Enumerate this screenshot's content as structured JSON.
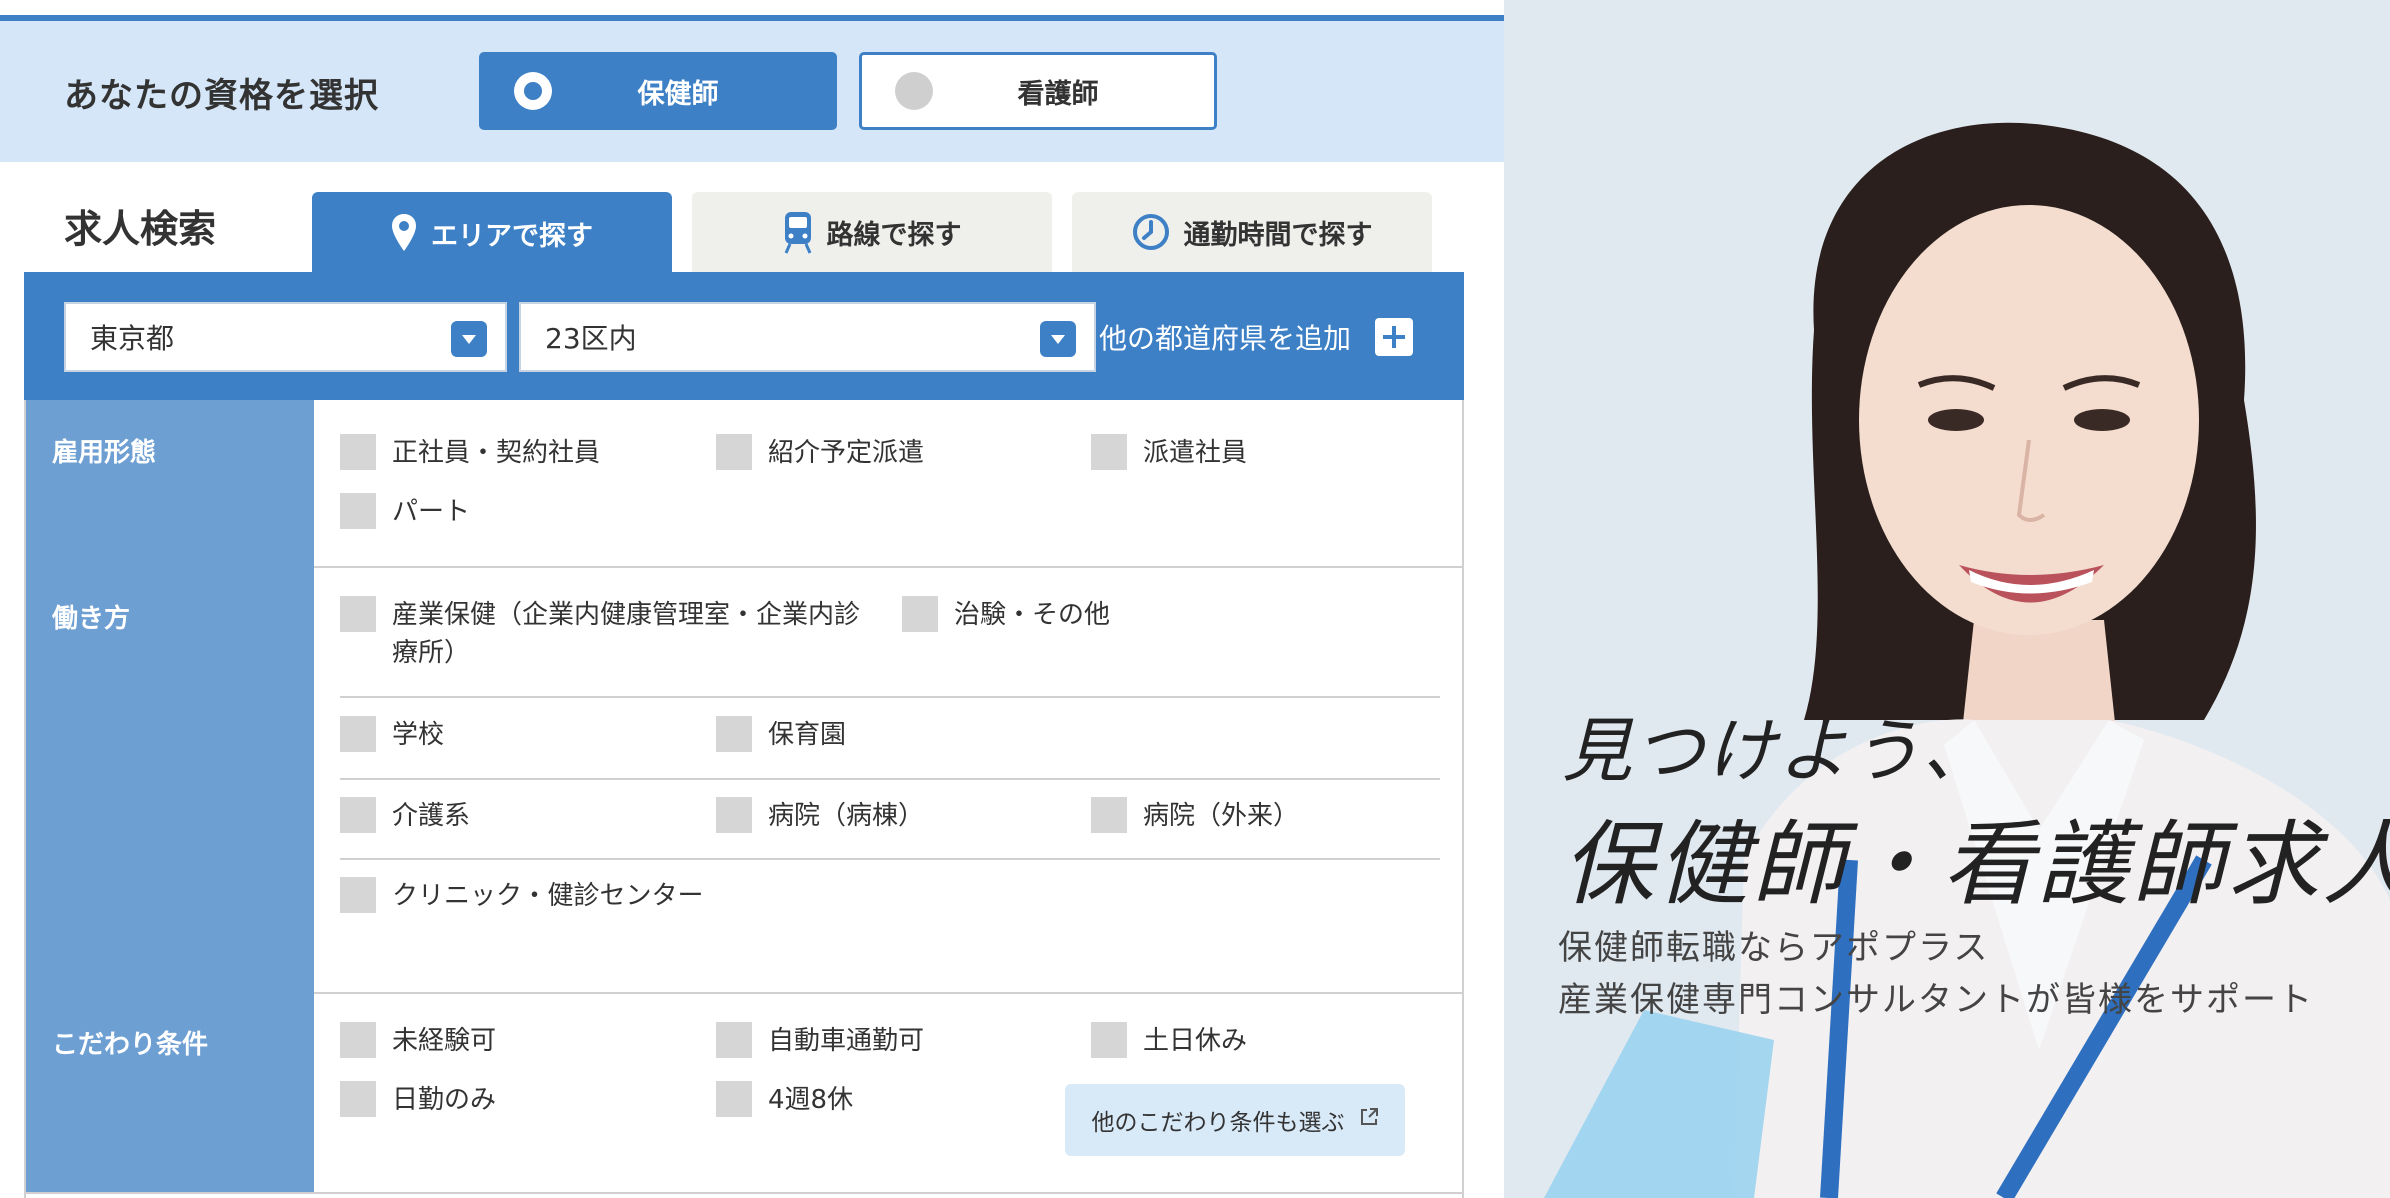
{
  "qualification": {
    "title": "あなたの資格を選択",
    "options": [
      {
        "label": "保健師",
        "selected": true
      },
      {
        "label": "看護師",
        "selected": false
      }
    ]
  },
  "search": {
    "title": "求人検索",
    "tabs": [
      {
        "label": "エリアで探す",
        "icon": "map-pin-icon",
        "active": true
      },
      {
        "label": "路線で探す",
        "icon": "train-icon",
        "active": false
      },
      {
        "label": "通勤時間で探す",
        "icon": "clock-icon",
        "active": false
      }
    ],
    "prefecture": "東京都",
    "city": "23区内",
    "add_prefecture": "他の都道府県を追加"
  },
  "conditions": {
    "employment": {
      "label": "雇用形態",
      "options": [
        "正社員・契約社員",
        "紹介予定派遣",
        "派遣社員",
        "パート"
      ]
    },
    "workstyle": {
      "label": "働き方",
      "options": [
        "産業保健（企業内健康管理室・企業内診療所）",
        "治験・その他",
        "学校",
        "保育園",
        "介護系",
        "病院（病棟）",
        "病院（外来）",
        "クリニック・健診センター"
      ]
    },
    "preferences": {
      "label": "こだわり条件",
      "options": [
        "未経験可",
        "自動車通勤可",
        "土日休み",
        "日勤のみ",
        "4週8休"
      ],
      "more_button": "他のこだわり条件も選ぶ"
    }
  },
  "hero": {
    "headline1": "見つけよう、",
    "headline2": "保健師・看護師求人",
    "sub1": "保健師転職ならアポプラス",
    "sub2": "産業保健専門コンサルタントが皆様をサポート"
  },
  "colors": {
    "primary": "#3d80c6",
    "header_cell": "#6e9fd3",
    "band": "#d4e6f7",
    "tab_inactive": "#efefec"
  }
}
